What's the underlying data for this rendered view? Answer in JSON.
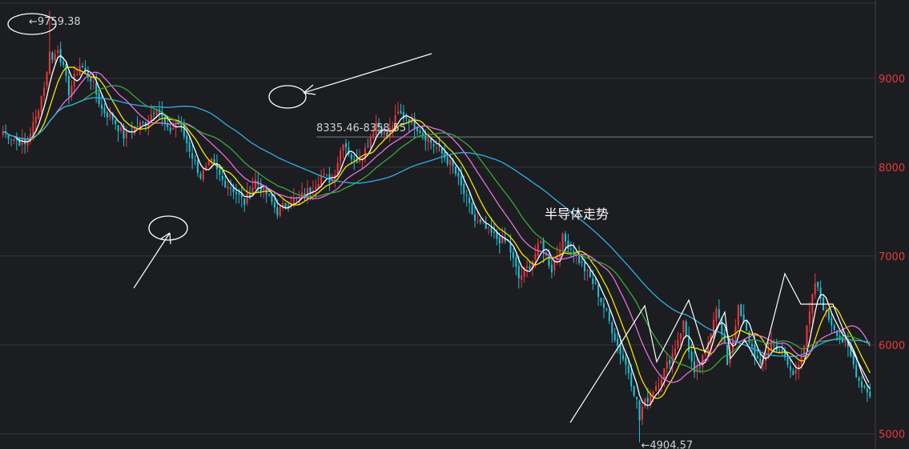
{
  "chart_data": {
    "type": "candlestick",
    "title": "半导体走势",
    "ylim": [
      4830,
      9880
    ],
    "ticks": [
      5000,
      6000,
      7000,
      8000,
      9000
    ],
    "tick_labels": [
      "5000",
      "6000",
      "7000",
      "8000",
      "9000"
    ],
    "grid": true,
    "annotations": {
      "high_label": "9759.38",
      "low_label": "4904.57",
      "range_label": "8335.46-8358.55"
    },
    "reference_level": 8340,
    "close_path": [
      8400,
      8320,
      8250,
      8550,
      9050,
      9350,
      8850,
      9150,
      9000,
      8650,
      8550,
      8350,
      8450,
      8500,
      8700,
      8400,
      8500,
      8200,
      7900,
      8050,
      7850,
      7750,
      7600,
      7850,
      7700,
      7500,
      7600,
      7650,
      7750,
      7900,
      7850,
      8300,
      8050,
      8200,
      8500,
      8350,
      8600,
      8550,
      8420,
      8280,
      8150,
      8000,
      7700,
      7400,
      7300,
      7200,
      7150,
      6750,
      6900,
      7150,
      6850,
      7200,
      7050,
      6850,
      6650,
      6350,
      6000,
      5700,
      5250,
      5450,
      5650,
      5900,
      6250,
      5650,
      5900,
      6450,
      5800,
      6400,
      6050,
      5750,
      6050,
      5900,
      5650,
      6000,
      6700,
      6350,
      6150,
      5950,
      5600,
      5450
    ],
    "series": [
      {
        "name": "MA5",
        "color": "#ffffff",
        "period": 5
      },
      {
        "name": "MA10",
        "color": "#f5e600",
        "period": 10
      },
      {
        "name": "MA20",
        "color": "#e86fe0",
        "period": 20
      },
      {
        "name": "MA30",
        "color": "#3aa83a",
        "period": 30
      },
      {
        "name": "MA60",
        "color": "#2fb0e6",
        "period": 60
      }
    ],
    "colors": {
      "up": "#e8393b",
      "down": "#1fc0d6",
      "grid": "#34363c",
      "axis_text": "#e8393b",
      "text": "#d0d0d0",
      "title": "#ffffff"
    }
  }
}
